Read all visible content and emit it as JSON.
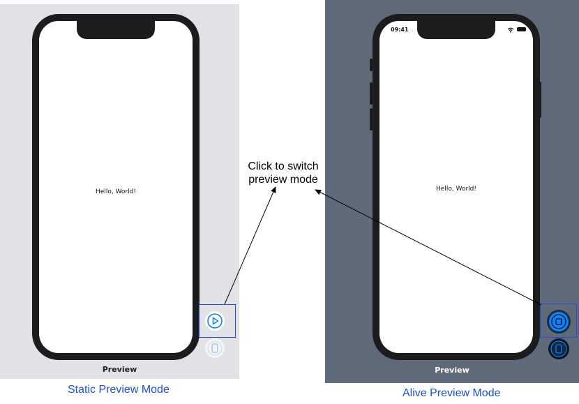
{
  "static_mode": {
    "preview_label": "Preview",
    "caption": "Static Preview Mode",
    "screen_text": "Hello, World!",
    "play_button_icon": "play-icon",
    "device_button_icon": "device-icon"
  },
  "alive_mode": {
    "preview_label": "Preview",
    "caption": "Alive Preview Mode",
    "screen_text": "Hello, World!",
    "status_time": "09:41",
    "stop_button_icon": "stop-icon",
    "device_button_icon": "device-icon"
  },
  "annotation": {
    "line1": "Click to switch",
    "line2": "preview mode"
  },
  "colors": {
    "static_bg": "#e1e2e6",
    "alive_bg": "#5f6a7a",
    "accent": "#0a84ff",
    "caption": "#1d4fd6",
    "highlight": "#2b49d9"
  }
}
